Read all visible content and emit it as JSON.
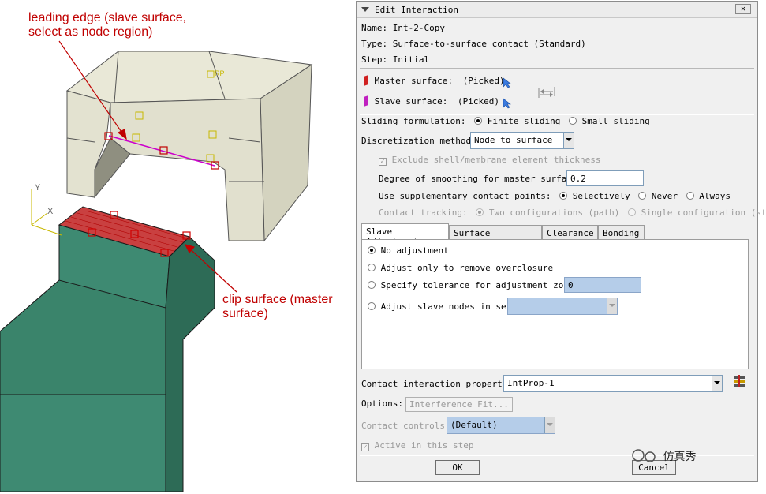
{
  "figure": {
    "annotation_top": [
      "leading edge (slave surface,",
      "select as node region)"
    ],
    "annotation_bottom": [
      "clip surface (master",
      "surface)"
    ],
    "axes": {
      "y": "Y",
      "x": "X"
    },
    "rp_label": "RP",
    "colors": {
      "upper_part": "#e9e8d7",
      "lower_part": "#3e8a72",
      "annotation": "#c00000",
      "selection": "#d00000",
      "slave_line": "#cc00cc"
    }
  },
  "dialog": {
    "title": "Edit Interaction",
    "close_label": "✕",
    "name_label": "Name:",
    "name_value": "Int-2-Copy",
    "type_label": "Type:",
    "type_value": "Surface-to-surface contact (Standard)",
    "step_label": "Step:",
    "step_value": "Initial",
    "master_label": "Master surface:",
    "master_value": "(Picked)",
    "slave_label": "Slave surface:",
    "slave_value": "(Picked)",
    "sliding_label": "Sliding formulation:",
    "sliding_options": [
      "Finite sliding",
      "Small sliding"
    ],
    "discretization_label": "Discretization method:",
    "discretization_value": "Node to surface",
    "exclude_label": "Exclude shell/membrane element thickness",
    "smoothing_label": "Degree of smoothing for master surface:",
    "smoothing_value": "0.2",
    "supplementary_label": "Use supplementary contact points:",
    "supplementary_options": [
      "Selectively",
      "Never",
      "Always"
    ],
    "tracking_label": "Contact tracking:",
    "tracking_options": [
      "Two configurations (path)",
      "Single configuration (state)"
    ],
    "tabs": [
      "Slave Adjustment",
      "Surface Smoothing",
      "Clearance",
      "Bonding"
    ],
    "adjust_options": [
      "No adjustment",
      "Adjust only to remove overclosure",
      "Specify tolerance for adjustment zone:",
      "Adjust slave nodes in set:"
    ],
    "tolerance_value": "0",
    "property_label": "Contact interaction property:",
    "property_value": "IntProp-1",
    "options_label": "Options:",
    "interference_button": "Interference Fit...",
    "controls_label": "Contact controls:",
    "controls_value": "(Default)",
    "active_label": "Active in this step",
    "ok_label": "OK",
    "cancel_label": "Cancel",
    "watermark": "仿真秀"
  }
}
